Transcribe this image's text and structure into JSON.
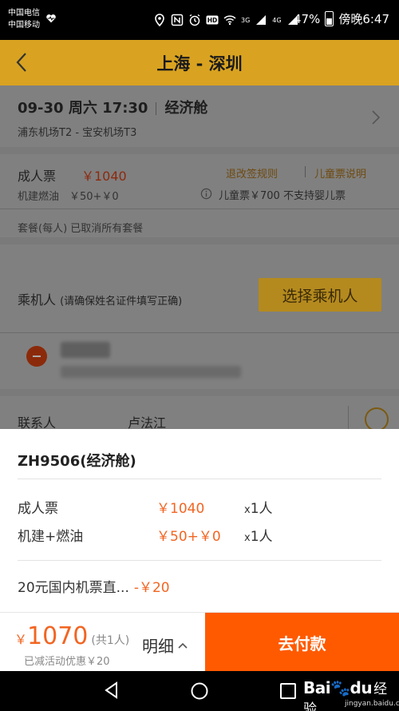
{
  "status_bar": {
    "carrier_1": "中国电信",
    "carrier_2": "中国移动",
    "signal_3g": "3G",
    "signal_4g": "4G",
    "battery": "47%",
    "time": "傍晚6:47"
  },
  "header": {
    "title": "上海 - 深圳"
  },
  "flight": {
    "date": "09-30",
    "weekday": "周六",
    "time": "17:30",
    "cabin": "经济舱",
    "airports": "浦东机场T2 - 宝安机场T3"
  },
  "price": {
    "adult_label": "成人票",
    "adult_price": "￥1040",
    "rules_link": "退改签规则",
    "child_link": "儿童票说明",
    "fuel": "机建燃油　￥50+￥0",
    "child_note": "儿童票￥700  不支持婴儿票",
    "package": "套餐(每人)   已取消所有套餐"
  },
  "passenger": {
    "label": "乘机人",
    "hint": "(请确保姓名证件填写正确)",
    "choose_button": "选择乘机人"
  },
  "contact": {
    "label": "联系人",
    "value": "卢法江"
  },
  "sheet": {
    "title": "ZH9506(经济舱)",
    "rows": [
      {
        "label": "成人票",
        "value": "￥1040",
        "qty_x": "x",
        "qty": "1人"
      },
      {
        "label": "机建+燃油",
        "value": "￥50+￥0",
        "qty_x": "x",
        "qty": "1人"
      }
    ],
    "discount_label": "20元国内机票直...",
    "discount_value": "-￥20"
  },
  "footer": {
    "currency": "￥",
    "total": "1070",
    "count": "(共1人)",
    "saved": "已减活动优惠￥20",
    "detail_label": "明细",
    "pay_label": "去付款"
  },
  "watermark": {
    "brand": "Bai",
    "brand_suffix": "du",
    "cn": "经验",
    "url": "jingyan.baidu.com"
  },
  "colors": {
    "header": "#d9a321",
    "accent": "#f26522",
    "pay_button": "#ff5a00"
  }
}
